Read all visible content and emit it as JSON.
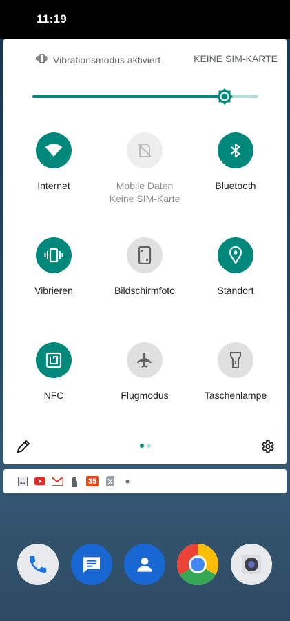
{
  "status_bar": {
    "time": "11:19"
  },
  "quick_settings": {
    "vibration_status": "Vibrationsmodus aktiviert",
    "carrier": "KEINE SIM-KARTE",
    "brightness": 0.85,
    "tiles": [
      {
        "label": "Internet",
        "state": "on",
        "icon": "wifi-icon"
      },
      {
        "label": "Mobile Daten",
        "sublabel": "Keine SIM-Karte",
        "state": "disabled",
        "icon": "mobile-data-icon"
      },
      {
        "label": "Bluetooth",
        "state": "on",
        "icon": "bluetooth-icon"
      },
      {
        "label": "Vibrieren",
        "state": "on",
        "icon": "vibrate-icon"
      },
      {
        "label": "Bildschirmfoto",
        "state": "off",
        "icon": "screenshot-icon"
      },
      {
        "label": "Standort",
        "state": "on",
        "icon": "location-icon"
      },
      {
        "label": "NFC",
        "state": "on",
        "icon": "nfc-icon"
      },
      {
        "label": "Flugmodus",
        "state": "off",
        "icon": "airplane-icon"
      },
      {
        "label": "Taschenlampe",
        "state": "off",
        "icon": "flashlight-icon"
      }
    ],
    "page_indicator": {
      "pages": 2,
      "current": 1
    }
  },
  "notifications": {
    "badge_number": "35",
    "icons": [
      "gallery-icon",
      "youtube-icon",
      "gmail-icon",
      "person-icon",
      "calendar-icon",
      "sim-icon",
      "more-dot-icon"
    ]
  },
  "dock": {
    "apps": [
      "phone-icon",
      "messages-icon",
      "contacts-icon",
      "chrome-icon",
      "camera-icon"
    ]
  },
  "colors": {
    "accent": "#00897b",
    "accent_light": "#b2dfdb",
    "tile_off": "#e0e0e0"
  }
}
